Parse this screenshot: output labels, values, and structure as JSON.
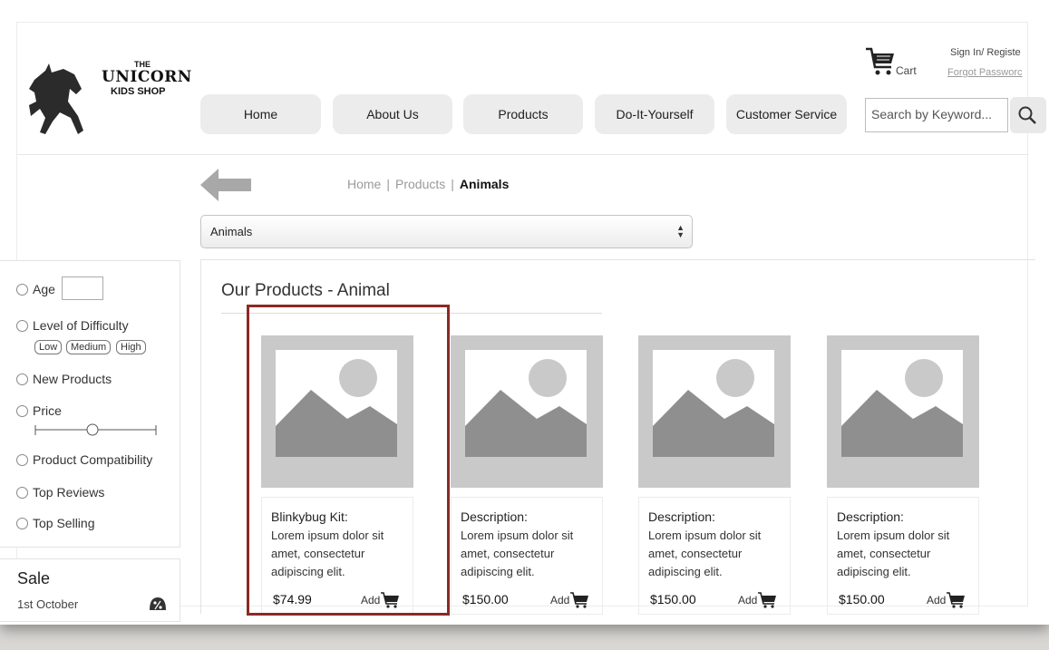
{
  "logo": {
    "the": "THE",
    "name": "UNICORN",
    "sub": "KIDS SHOP"
  },
  "nav": {
    "items": [
      {
        "label": "Home"
      },
      {
        "label": "About Us"
      },
      {
        "label": "Products"
      },
      {
        "label": "Do-It-Yourself"
      },
      {
        "label": "Customer Service"
      }
    ]
  },
  "account": {
    "cart_label": "Cart",
    "signin_label": "Sign In/ Registe",
    "forgot_label": "Forgot Passworc"
  },
  "search": {
    "placeholder": "Search by Keyword..."
  },
  "breadcrumb": {
    "home": "Home",
    "products": "Products",
    "current": "Animals",
    "separator": "|"
  },
  "category_select": {
    "value": "Animals"
  },
  "filters": {
    "age": "Age",
    "difficulty": "Level of Difficulty",
    "difficulty_levels": [
      "Low",
      "Medium",
      "High"
    ],
    "new_products": "New Products",
    "price": "Price",
    "compatibility": "Product Compatibility",
    "top_reviews": "Top Reviews",
    "top_selling": "Top Selling"
  },
  "sale": {
    "title": "Sale",
    "date": "1st October"
  },
  "products_section": {
    "title": "Our Products - Animal",
    "add_label": "Add",
    "items": [
      {
        "title": "Blinkybug Kit:",
        "body": "Lorem ipsum dolor sit amet, consectetur adipiscing elit.",
        "price": "$74.99"
      },
      {
        "title": "Description:",
        "body": "Lorem ipsum dolor sit amet, consectetur adipiscing elit.",
        "price": "$150.00"
      },
      {
        "title": "Description:",
        "body": "Lorem ipsum dolor sit amet, consectetur adipiscing elit.",
        "price": "$150.00"
      },
      {
        "title": "Description:",
        "body": "Lorem ipsum dolor sit amet, consectetur adipiscing elit.",
        "price": "$150.00"
      }
    ]
  },
  "colors": {
    "highlight": "#8a2a24",
    "nav_bg": "#ececec",
    "placeholder_img": "#c9c9c9"
  }
}
